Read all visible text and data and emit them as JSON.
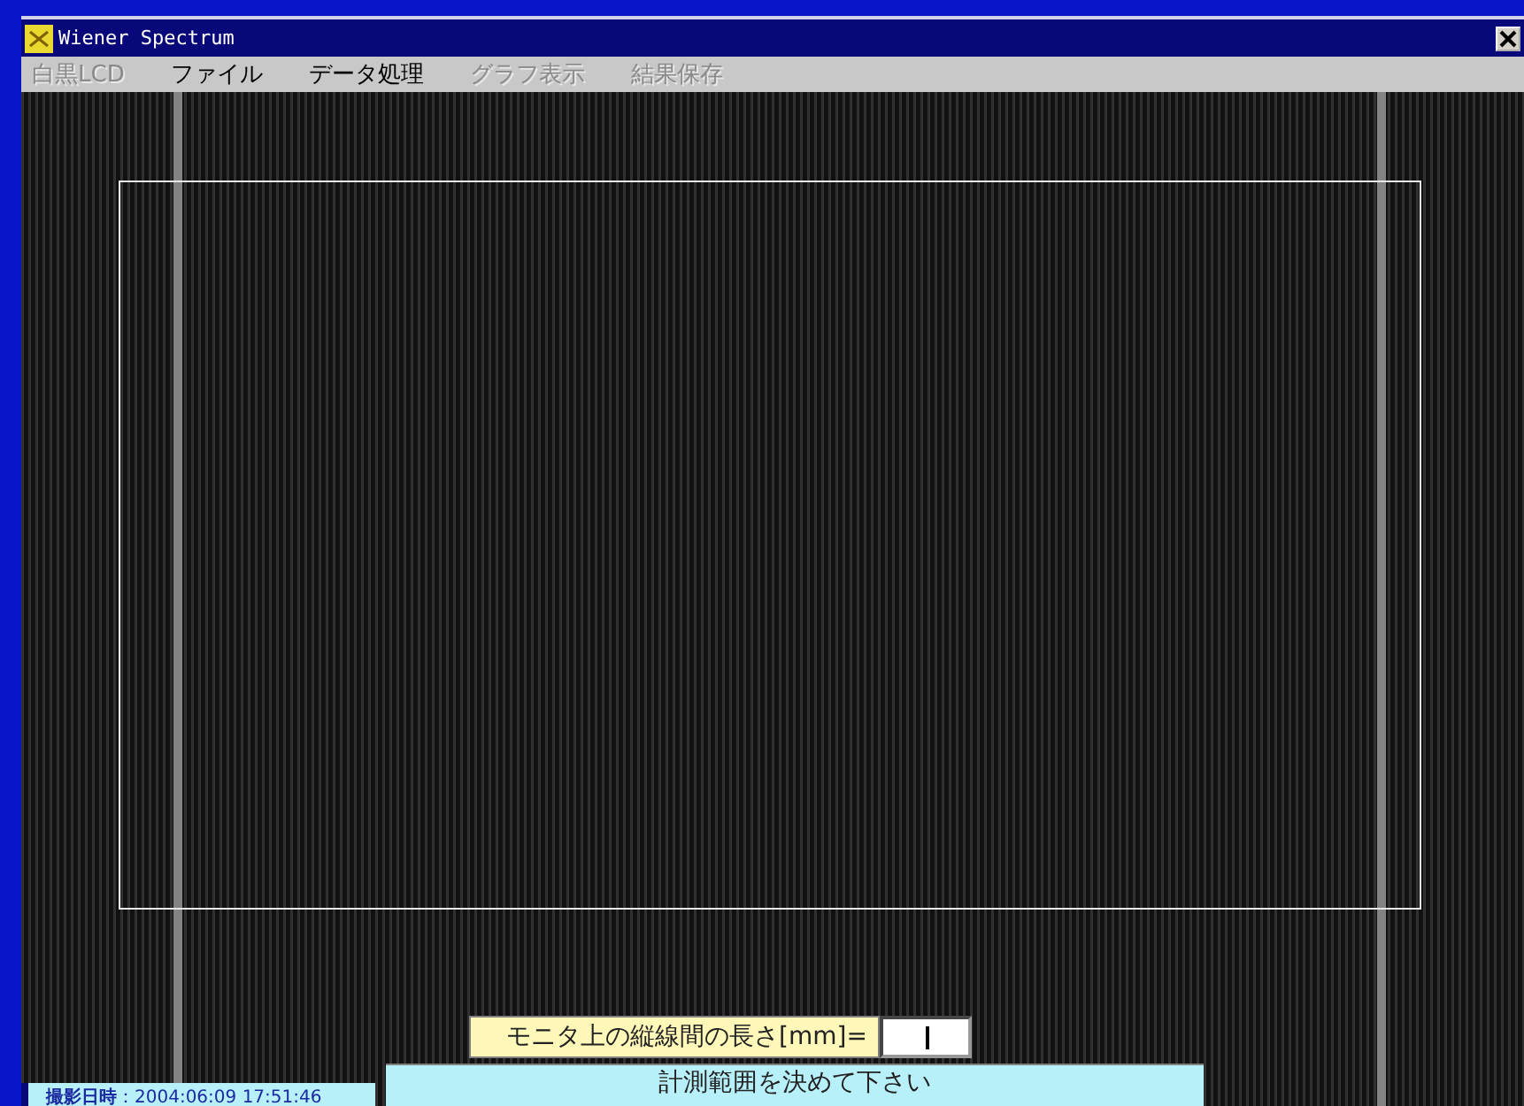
{
  "window": {
    "title": "Wiener Spectrum"
  },
  "menu": [
    {
      "label": "白黒LCD",
      "disabled": true
    },
    {
      "label": "ファイル",
      "disabled": false
    },
    {
      "label": "データ処理",
      "disabled": false
    },
    {
      "label": "グラフ表示",
      "disabled": true
    },
    {
      "label": "結果保存",
      "disabled": true
    }
  ],
  "prompt": {
    "label": "モニタ上の縦線間の長さ[mm]="
  },
  "status": {
    "timestamp_label": "撮影日時",
    "timestamp": "：2004:06:09 17:51:46",
    "message": "計測範囲を決めて下さい"
  }
}
